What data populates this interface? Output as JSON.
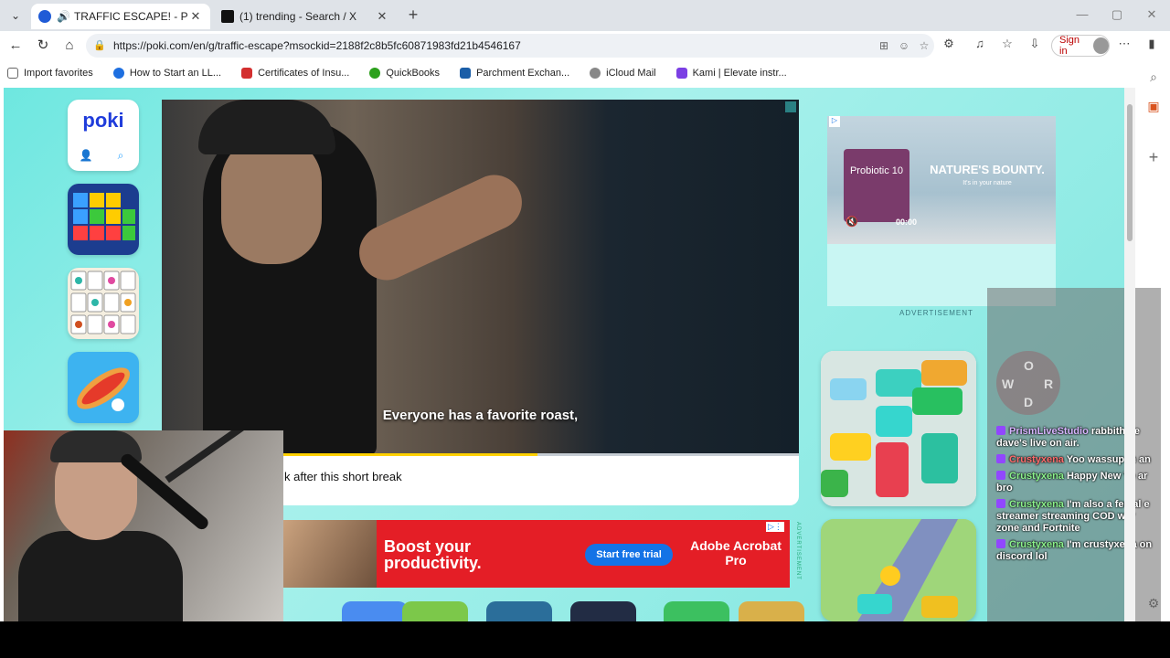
{
  "browser": {
    "tabs": [
      {
        "title": "TRAFFIC ESCAPE! - Play Onlin",
        "active": true
      },
      {
        "title": "(1) trending - Search / X",
        "active": false
      }
    ],
    "url": "https://poki.com/en/g/traffic-escape?msockid=2188f2c8b5fc60871983fd21b4546167",
    "sign_in_label": "Sign in",
    "bookmarks": [
      "Import favorites",
      "How to Start an LL...",
      "Certificates of Insu...",
      "QuickBooks",
      "Parchment Exchan...",
      "iCloud Mail",
      "Kami | Elevate instr..."
    ]
  },
  "poki": {
    "logo": "poki"
  },
  "video": {
    "subtitle": "Everyone has a favorite roast,",
    "progress_fraction": 0.59,
    "break_text": "k after this short break"
  },
  "adobe_ad": {
    "headline": "Boost your productivity.",
    "button": "Start free trial",
    "brand": "Adobe Acrobat Pro",
    "side_label": "ADVERTISEMENT"
  },
  "nb_ad": {
    "product": "Probiotic 10",
    "brand": "NATURE'S BOUNTY.",
    "tagline": "It's in your nature",
    "time": "00:00",
    "label": "ADVERTISEMENT"
  },
  "chat": [
    {
      "user": "PrismLiveStudio",
      "text": "rabbithole dave's live on air.",
      "color": "purple"
    },
    {
      "user": "Crustyxena",
      "text": "Yoo wassup m an",
      "color": "red"
    },
    {
      "user": "Crustyxena",
      "text": "Happy New Ye ar bro",
      "color": "green"
    },
    {
      "user": "Crustyxena",
      "text": "I'm also a femal e streamer streaming COD war zone and Fortnite",
      "color": "green"
    },
    {
      "user": "Crustyxena",
      "text": "I'm crustyxena on discord lol",
      "color": "green"
    }
  ],
  "wordgame_letters": [
    "O",
    "W",
    "R",
    "D"
  ]
}
